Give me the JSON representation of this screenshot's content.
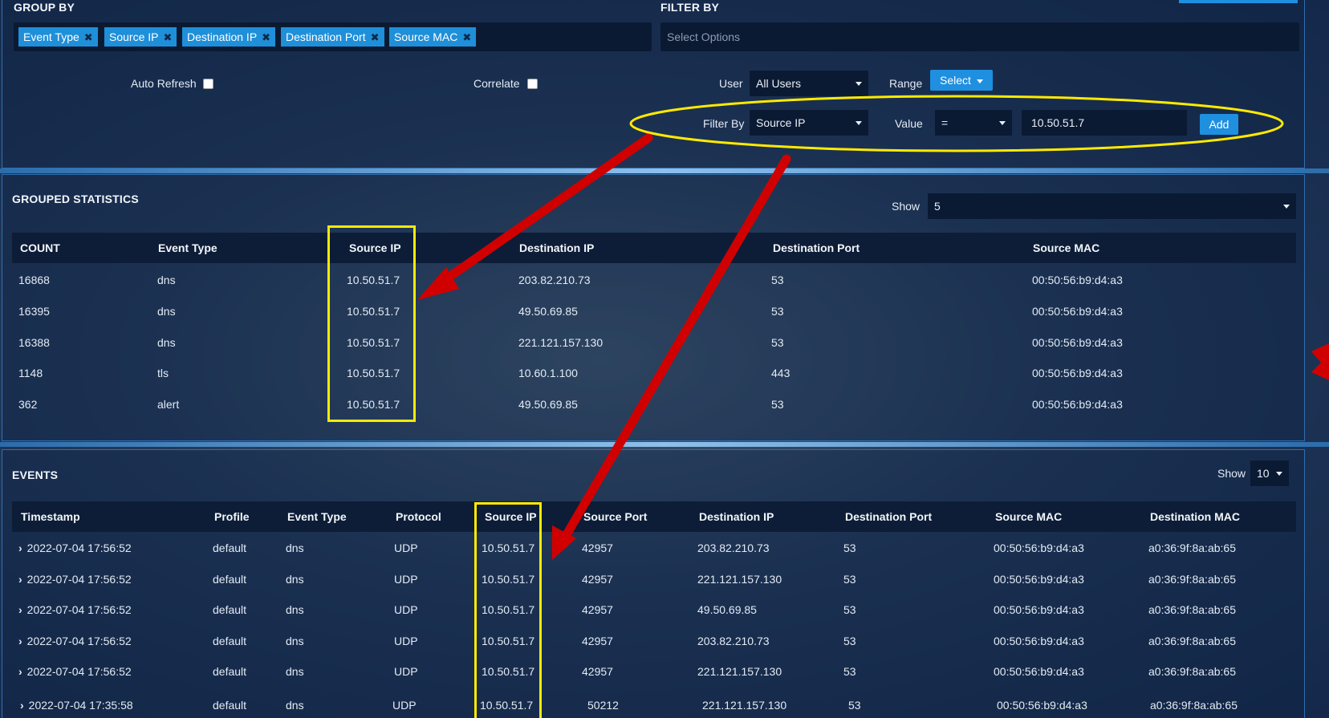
{
  "filter_panel": {
    "group_by_label": "GROUP BY",
    "filter_by_label": "FILTER BY",
    "group_tags": [
      "Event Type",
      "Source IP",
      "Destination IP",
      "Destination Port",
      "Source MAC"
    ],
    "filter_options_placeholder": "Select Options",
    "auto_refresh_label": "Auto Refresh",
    "correlate_label": "Correlate",
    "user_label": "User",
    "user_value": "All Users",
    "range_label": "Range",
    "range_button": "Select",
    "filter_by_field_label": "Filter By",
    "filter_by_value": "Source IP",
    "value_label": "Value",
    "operator_value": "=",
    "value_input": "10.50.51.7",
    "add_button": "Add"
  },
  "stats": {
    "title": "GROUPED STATISTICS",
    "show_label": "Show",
    "show_value": "5",
    "columns": [
      "COUNT",
      "Event Type",
      "Source IP",
      "Destination IP",
      "Destination Port",
      "Source MAC"
    ],
    "rows": [
      [
        "16868",
        "dns",
        "10.50.51.7",
        "203.82.210.73",
        "53",
        "00:50:56:b9:d4:a3"
      ],
      [
        "16395",
        "dns",
        "10.50.51.7",
        "49.50.69.85",
        "53",
        "00:50:56:b9:d4:a3"
      ],
      [
        "16388",
        "dns",
        "10.50.51.7",
        "221.121.157.130",
        "53",
        "00:50:56:b9:d4:a3"
      ],
      [
        "1148",
        "tls",
        "10.50.51.7",
        "10.60.1.100",
        "443",
        "00:50:56:b9:d4:a3"
      ],
      [
        "362",
        "alert",
        "10.50.51.7",
        "49.50.69.85",
        "53",
        "00:50:56:b9:d4:a3"
      ]
    ]
  },
  "events": {
    "title": "EVENTS",
    "show_label": "Show",
    "show_value": "10",
    "columns": [
      "Timestamp",
      "Profile",
      "Event Type",
      "Protocol",
      "Source IP",
      "Source Port",
      "Destination IP",
      "Destination Port",
      "Source MAC",
      "Destination MAC"
    ],
    "rows": [
      [
        "2022-07-04 17:56:52",
        "default",
        "dns",
        "UDP",
        "10.50.51.7",
        "42957",
        "203.82.210.73",
        "53",
        "00:50:56:b9:d4:a3",
        "a0:36:9f:8a:ab:65"
      ],
      [
        "2022-07-04 17:56:52",
        "default",
        "dns",
        "UDP",
        "10.50.51.7",
        "42957",
        "221.121.157.130",
        "53",
        "00:50:56:b9:d4:a3",
        "a0:36:9f:8a:ab:65"
      ],
      [
        "2022-07-04 17:56:52",
        "default",
        "dns",
        "UDP",
        "10.50.51.7",
        "42957",
        "49.50.69.85",
        "53",
        "00:50:56:b9:d4:a3",
        "a0:36:9f:8a:ab:65"
      ],
      [
        "2022-07-04 17:56:52",
        "default",
        "dns",
        "UDP",
        "10.50.51.7",
        "42957",
        "203.82.210.73",
        "53",
        "00:50:56:b9:d4:a3",
        "a0:36:9f:8a:ab:65"
      ],
      [
        "2022-07-04 17:56:52",
        "default",
        "dns",
        "UDP",
        "10.50.51.7",
        "42957",
        "221.121.157.130",
        "53",
        "00:50:56:b9:d4:a3",
        "a0:36:9f:8a:ab:65"
      ],
      [
        "2022-07-04 17:35:58",
        "default",
        "dns",
        "UDP",
        "10.50.51.7",
        "50212",
        "221.121.157.130",
        "53",
        "00:50:56:b9:d4:a3",
        "a0:36:9f:8a:ab:65"
      ]
    ]
  },
  "colors": {
    "accent_blue": "#1f8fe0",
    "highlight_yellow": "#ffea00",
    "arrow_red": "#d10000"
  }
}
